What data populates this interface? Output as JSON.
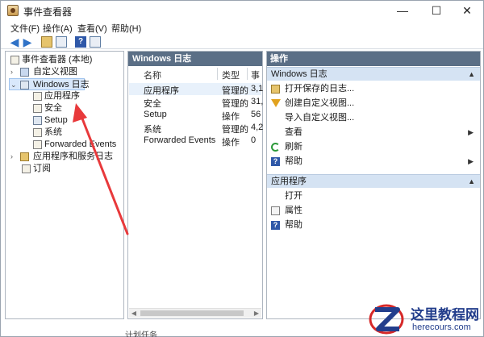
{
  "window": {
    "title": "事件查看器",
    "controls": {
      "minimize": "—",
      "maximize": "☐",
      "close": "✕"
    }
  },
  "menu": [
    "文件(F)",
    "操作(A)",
    "查看(V)",
    "帮助(H)"
  ],
  "tree": {
    "root": "事件查看器 (本地)",
    "custom_views": "自定义视图",
    "windows_logs": "Windows 日志",
    "logs": [
      "应用程序",
      "安全",
      "Setup",
      "系统",
      "Forwarded Events"
    ],
    "apps_services": "应用程序和服务日志",
    "subscriptions": "订阅"
  },
  "middle": {
    "header": "Windows 日志",
    "columns": [
      "名称",
      "类型",
      "事"
    ],
    "rows": [
      {
        "name": "应用程序",
        "type": "管理的",
        "count": "3,1"
      },
      {
        "name": "安全",
        "type": "管理的",
        "count": "31,"
      },
      {
        "name": "Setup",
        "type": "操作",
        "count": "56"
      },
      {
        "name": "系统",
        "type": "管理的",
        "count": "4,2"
      },
      {
        "name": "Forwarded Events",
        "type": "操作",
        "count": "0"
      }
    ]
  },
  "actions": {
    "header": "操作",
    "section1": {
      "title": "Windows 日志",
      "items": [
        {
          "label": "打开保存的日志...",
          "icon": "folder-icon"
        },
        {
          "label": "创建自定义视图...",
          "icon": "filter-icon"
        },
        {
          "label": "导入自定义视图...",
          "icon": "none"
        },
        {
          "label": "查看",
          "icon": "none"
        },
        {
          "label": "刷新",
          "icon": "refresh-icon"
        },
        {
          "label": "帮助",
          "icon": "help-icon"
        }
      ]
    },
    "section2": {
      "title": "应用程序",
      "items": [
        {
          "label": "打开",
          "icon": "none"
        },
        {
          "label": "属性",
          "icon": "properties-icon"
        },
        {
          "label": "帮助",
          "icon": "help-icon"
        }
      ]
    }
  },
  "watermark": {
    "title": "这里教程网",
    "url": "herecours.com"
  },
  "bottom_partial": "计划任务",
  "colors": {
    "pane_header": "#5b6f86",
    "section_header": "#d5e3f3",
    "annotation_arrow": "#e8393b",
    "selection": "#d9e8fb"
  }
}
